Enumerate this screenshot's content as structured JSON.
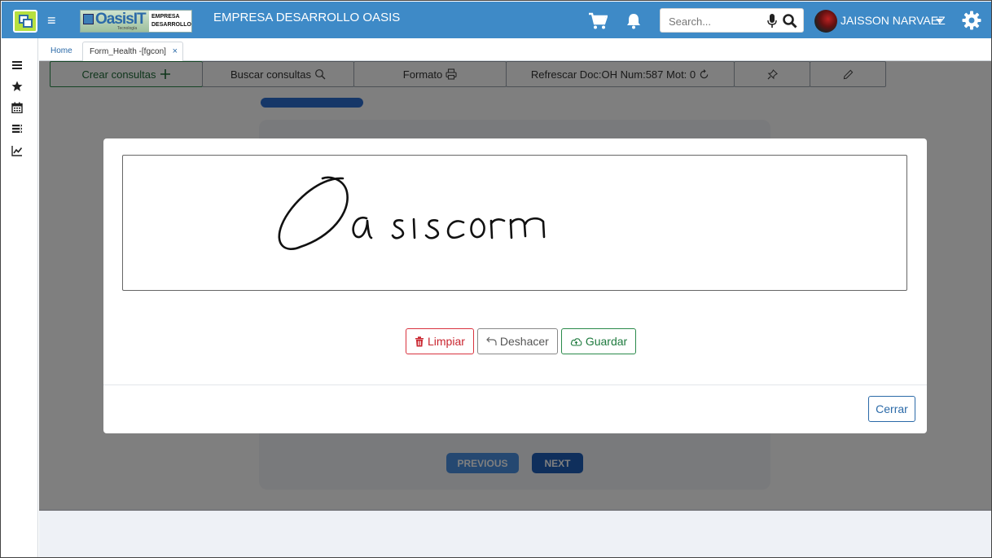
{
  "header": {
    "company": "EMPRESA DESARROLLO OASIS",
    "brand_name": "OasisIT",
    "brand_sub": "Tecnología",
    "brand_tag_1": "EMPRESA",
    "brand_tag_2": "DESARROLLO",
    "search_placeholder": "Search...",
    "user": "JAISSON NARVAEZ",
    "accent_color": "#3e8ac7"
  },
  "sidebar": {
    "icons": [
      "menu-icon",
      "star-icon",
      "calendar-icon",
      "list-icon",
      "chart-icon"
    ]
  },
  "tabs": {
    "home": "Home",
    "form": "Form_Health -[fgcon]",
    "close": "×"
  },
  "toolbar": {
    "create": "Crear consultas",
    "search": "Buscar consultas",
    "format": "Formato",
    "refresh": "Refrescar Doc:OH Num:587 Mot: 0"
  },
  "wizard": {
    "previous": "PREVIOUS",
    "next": "NEXT"
  },
  "modal": {
    "clear": "Limpiar",
    "undo": "Deshacer",
    "save": "Guardar",
    "close": "Cerrar"
  }
}
